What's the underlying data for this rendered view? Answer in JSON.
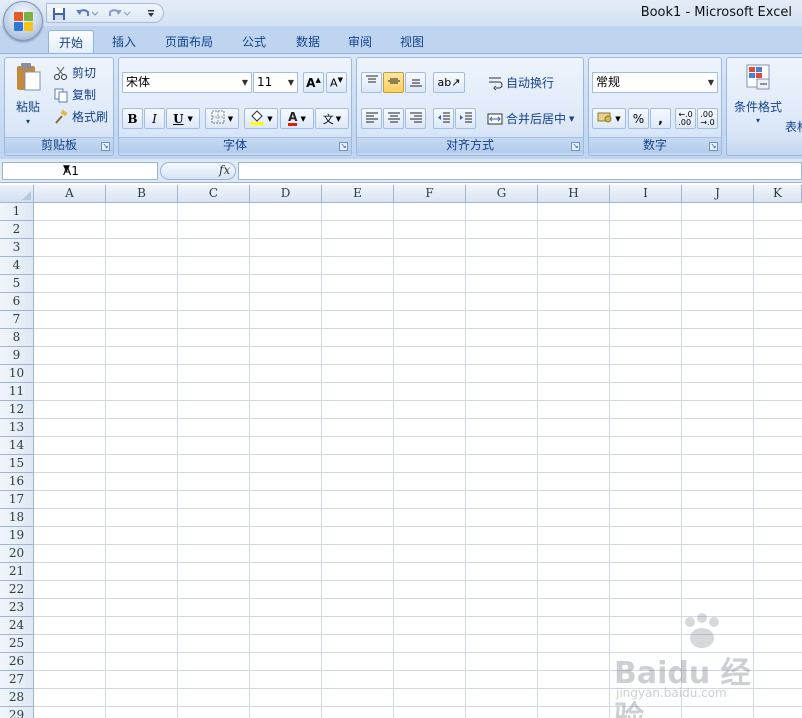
{
  "window": {
    "title": "Book1 - Microsoft Excel"
  },
  "tabs": [
    {
      "label": "开始",
      "active": true
    },
    {
      "label": "插入"
    },
    {
      "label": "页面布局"
    },
    {
      "label": "公式"
    },
    {
      "label": "数据"
    },
    {
      "label": "审阅"
    },
    {
      "label": "视图"
    }
  ],
  "clipboard": {
    "paste": "粘贴",
    "cut": "剪切",
    "copy": "复制",
    "format_painter": "格式刷",
    "group": "剪贴板"
  },
  "font": {
    "name": "宋体",
    "size": "11",
    "group": "字体",
    "bold": "B",
    "italic": "I",
    "underline": "U"
  },
  "alignment": {
    "wrap_text": "自动换行",
    "merge_center": "合并后居中",
    "group": "对齐方式"
  },
  "number": {
    "format": "常规",
    "group": "数字",
    "percent": "%",
    "comma": ","
  },
  "styles": {
    "conditional_format": "条件格式",
    "table": "表格"
  },
  "formula_bar": {
    "name_box": "A1",
    "fx": "fx"
  },
  "columns": [
    "A",
    "B",
    "C",
    "D",
    "E",
    "F",
    "G",
    "H",
    "I",
    "J",
    "K"
  ],
  "rows": [
    "1",
    "2",
    "3",
    "4",
    "5",
    "6",
    "7",
    "8",
    "9",
    "10",
    "11",
    "12",
    "13",
    "14",
    "15",
    "16",
    "17",
    "18",
    "19",
    "20",
    "21",
    "22",
    "23",
    "24",
    "25",
    "26",
    "27",
    "28",
    "29"
  ],
  "colors": {
    "ribbon": "#c7dbf3",
    "accent": "#15428b",
    "grid": "#d0d7e5"
  }
}
